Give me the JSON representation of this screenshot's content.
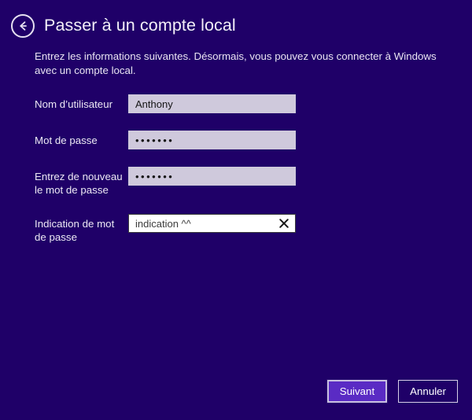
{
  "window": {
    "title": "Passer à un compte local",
    "background_color": "#1f0068"
  },
  "header": {
    "back_icon": "back-arrow-circle-icon",
    "title": "Passer à un compte local"
  },
  "description": "Entrez les informations suivantes. Désormais, vous pouvez vous connecter à Windows avec un compte local.",
  "form": {
    "fields": [
      {
        "label": "Nom d’utilisateur",
        "value": "Anthony",
        "placeholder": "",
        "type": "text",
        "state": "filled"
      },
      {
        "label": "Mot de passe",
        "value": "•••••••",
        "placeholder": "",
        "type": "password",
        "state": "filled",
        "masked_length": 7
      },
      {
        "label": "Entrez de nouveau le mot de passe",
        "value": "•••••••",
        "placeholder": "",
        "type": "password",
        "state": "filled",
        "masked_length": 7
      },
      {
        "label": "Indication de mot de passe",
        "value": "indication ^^",
        "placeholder": "",
        "type": "text",
        "state": "focused",
        "clear_icon": "close-x-icon"
      }
    ]
  },
  "footer": {
    "next_label": "Suivant",
    "cancel_label": "Annuler",
    "accent_color": "#5a2bc4",
    "border_color": "#c9c0e0"
  }
}
